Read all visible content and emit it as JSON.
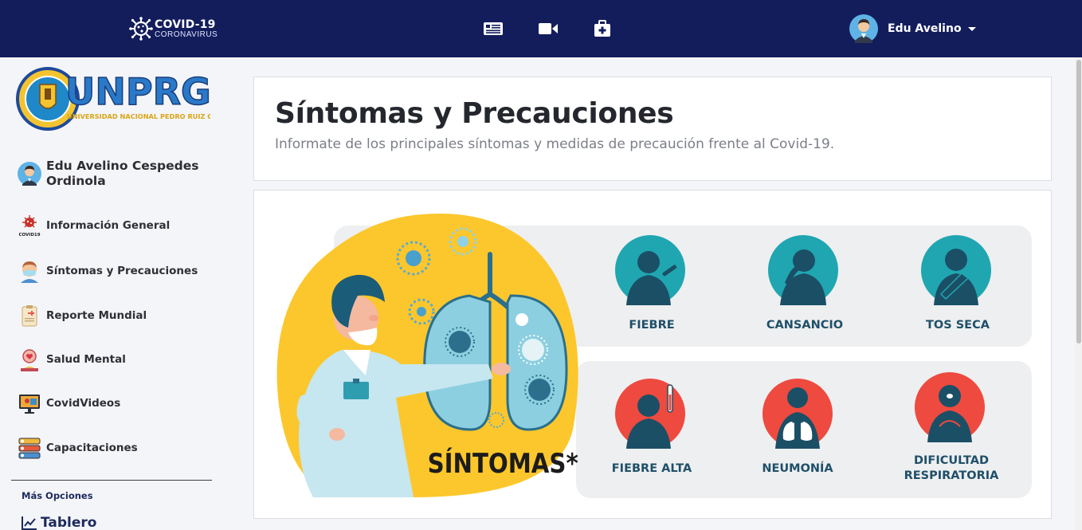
{
  "navbar": {
    "brand_title": "COVID-19",
    "brand_sub": "CORONAVIRUS",
    "icons": [
      "news-icon",
      "video-camera-icon",
      "medical-kit-icon"
    ],
    "user_name": "Edu Avelino"
  },
  "sidebar": {
    "logo_text": "UNPRG",
    "logo_subtext": "UNIVERSIDAD NACIONAL PEDRO RUIZ GALLO",
    "profile_name": "Edu Avelino Cespedes Ordinola",
    "items": [
      {
        "label": "Información General",
        "icon": "covid19-icon",
        "icon_caption": "COVID19"
      },
      {
        "label": "Síntomas y Precauciones",
        "icon": "masked-person-icon"
      },
      {
        "label": "Reporte Mundial",
        "icon": "clipboard-report-icon"
      },
      {
        "label": "Salud Mental",
        "icon": "mental-health-icon"
      },
      {
        "label": "CovidVideos",
        "icon": "video-monitor-icon"
      },
      {
        "label": "Capacitaciones",
        "icon": "training-list-icon"
      }
    ],
    "more_options_label": "Más Opciones",
    "tablero_label": "Tablero"
  },
  "header": {
    "title": "Síntomas y Precauciones",
    "subtitle": "Informate de los principales síntomas y medidas de precaución frente al Covid-19."
  },
  "infographic": {
    "label": "SÍNTOMAS*",
    "symptoms_row1": [
      "FIEBRE",
      "CANSANCIO",
      "TOS SECA"
    ],
    "symptoms_row2": [
      "FIEBRE ALTA",
      "NEUMONÍA",
      "DIFICULTAD RESPIRATORIA"
    ],
    "colors": {
      "mild": "#1fa6b1",
      "severe": "#ee4a3f",
      "figure": "#1b4f66",
      "blob": "#fcc72c",
      "panel": "#eeeff0"
    }
  },
  "theme": {
    "navbar_bg": "#131d5c",
    "accent": "#1d2a5c"
  }
}
